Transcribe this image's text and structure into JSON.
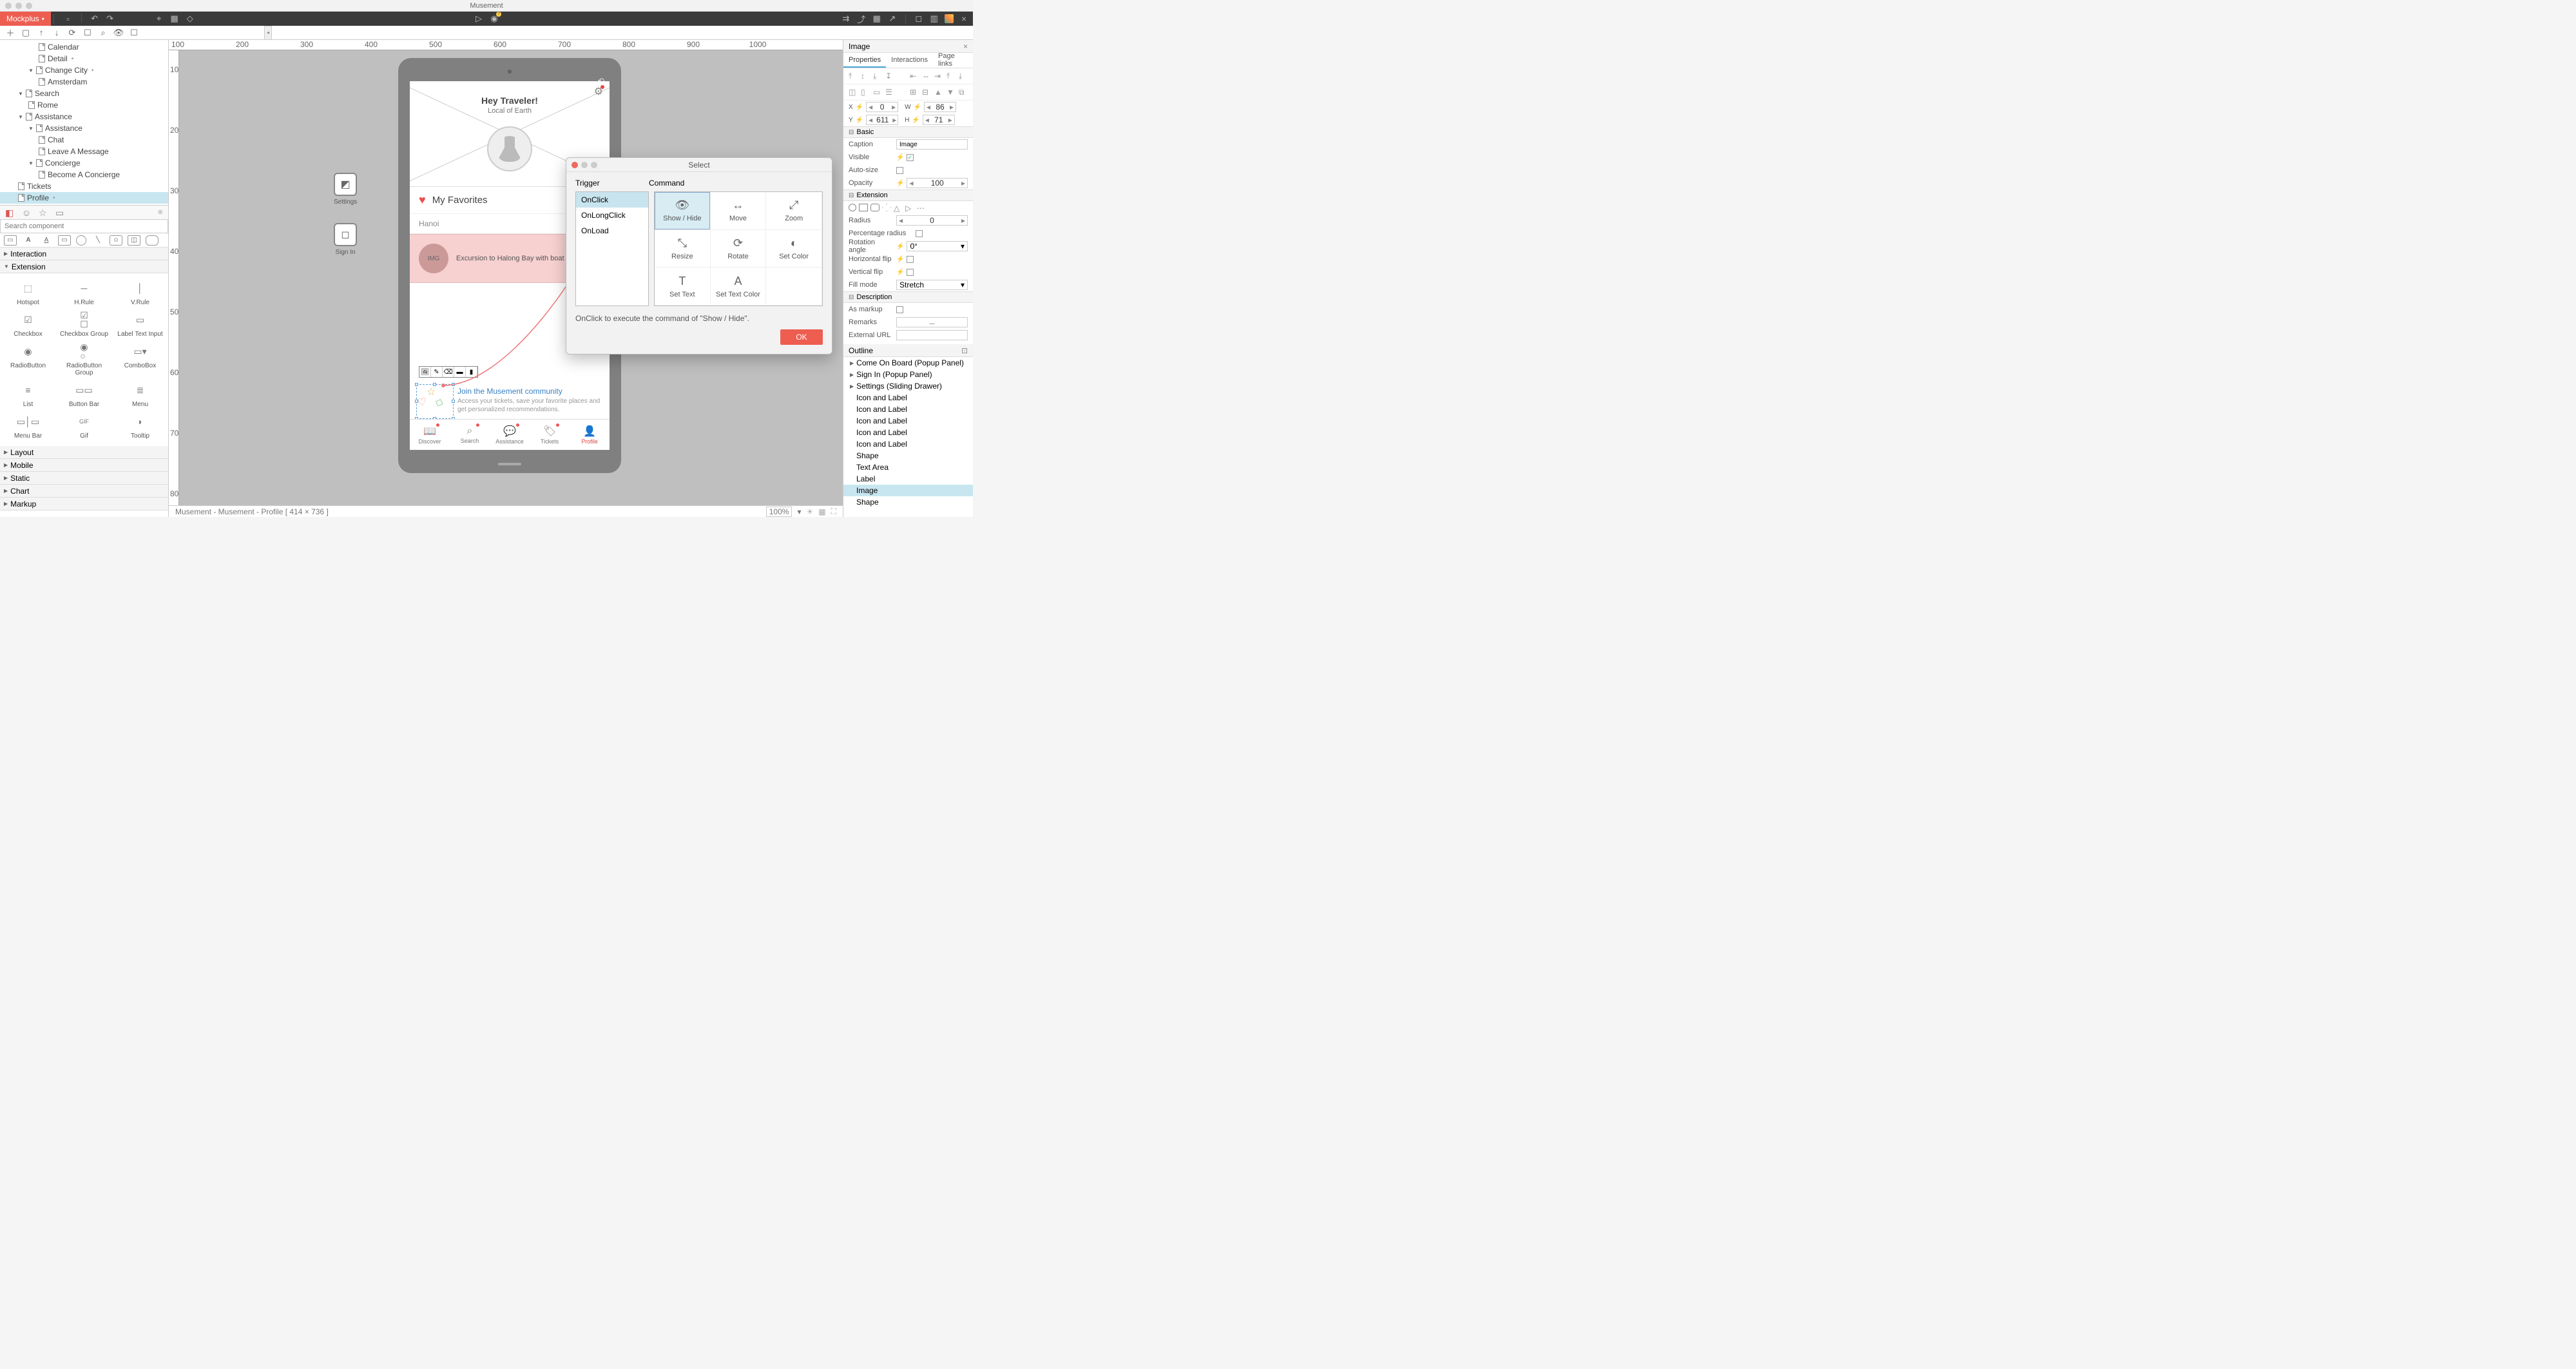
{
  "app_title": "Musement",
  "brand": "Mockplus",
  "tree": {
    "items": [
      {
        "label": "Calendar",
        "depth": 3,
        "icon": "page"
      },
      {
        "label": "Detail",
        "depth": 3,
        "icon": "page",
        "modified": true
      },
      {
        "label": "Change City",
        "depth": 2,
        "icon": "page",
        "expanded": true,
        "modified": true
      },
      {
        "label": "Amsterdam",
        "depth": 3,
        "icon": "page"
      },
      {
        "label": "Search",
        "depth": 1,
        "icon": "page",
        "expanded": true
      },
      {
        "label": "Rome",
        "depth": 2,
        "icon": "page"
      },
      {
        "label": "Assistance",
        "depth": 1,
        "icon": "page",
        "expanded": true
      },
      {
        "label": "Assistance",
        "depth": 2,
        "icon": "page",
        "expanded": true
      },
      {
        "label": "Chat",
        "depth": 3,
        "icon": "page"
      },
      {
        "label": "Leave A Message",
        "depth": 3,
        "icon": "page"
      },
      {
        "label": "Concierge",
        "depth": 2,
        "icon": "page",
        "expanded": true
      },
      {
        "label": "Become A Concierge",
        "depth": 3,
        "icon": "page"
      },
      {
        "label": "Tickets",
        "depth": 1,
        "icon": "page"
      },
      {
        "label": "Profile",
        "depth": 1,
        "icon": "page",
        "selected": true,
        "modified": true
      }
    ]
  },
  "component_search_placeholder": "Search component",
  "component_sections": {
    "interaction": {
      "label": "Interaction",
      "open": false
    },
    "extension": {
      "label": "Extension",
      "open": true,
      "items": [
        {
          "label": "Hotspot"
        },
        {
          "label": "H.Rule"
        },
        {
          "label": "V.Rule"
        },
        {
          "label": "Checkbox"
        },
        {
          "label": "Checkbox Group"
        },
        {
          "label": "Label Text Input"
        },
        {
          "label": "RadioButton"
        },
        {
          "label": "RadioButton Group"
        },
        {
          "label": "ComboBox"
        },
        {
          "label": "List"
        },
        {
          "label": "Button Bar"
        },
        {
          "label": "Menu"
        },
        {
          "label": "Menu Bar"
        },
        {
          "label": "Gif"
        },
        {
          "label": "Tooltip"
        }
      ]
    },
    "collapsed": [
      {
        "label": "Layout"
      },
      {
        "label": "Mobile"
      },
      {
        "label": "Static"
      },
      {
        "label": "Chart"
      },
      {
        "label": "Markup"
      }
    ]
  },
  "ruler_h": [
    "100",
    "200",
    "300",
    "400",
    "500",
    "600",
    "700",
    "800",
    "900",
    "1000"
  ],
  "ruler_v": [
    "100",
    "200",
    "300",
    "400",
    "500",
    "600",
    "700",
    "800"
  ],
  "float_settings": "Settings",
  "float_signin": "Sign In",
  "artboard": {
    "hero_title": "Hey Traveler!",
    "hero_sub": "Local of Earth",
    "fav_title": "My Favorites",
    "city": "Hanoi",
    "card_img": "IMG",
    "card_text": "Excursion to Halong Bay with boat rid",
    "join_title": "Join the Musement community",
    "join_desc": "Access your tickets, save your favorite places and get personalized recommendations.",
    "tabs": [
      "Discover",
      "Search",
      "Assistance",
      "Tickets",
      "Profile"
    ]
  },
  "dialog": {
    "title": "Select",
    "trigger_label": "Trigger",
    "command_label": "Command",
    "triggers": [
      "OnClick",
      "OnLongClick",
      "OnLoad"
    ],
    "trigger_selected": "OnClick",
    "commands": [
      "Show / Hide",
      "Move",
      "Zoom",
      "Resize",
      "Rotate",
      "Set Color",
      "Set Text",
      "Set Text Color"
    ],
    "command_selected": "Show / Hide",
    "desc": "OnClick to execute the command of \"Show / Hide\".",
    "ok": "OK"
  },
  "status_text": "Musement - Musement - Profile [ 414 × 736 ]",
  "zoom": "100%",
  "right_panel": {
    "title": "Image",
    "tabs": [
      "Properties",
      "Interactions",
      "Page links"
    ],
    "X": "0",
    "Y": "611",
    "W": "86",
    "H": "71",
    "basic": "Basic",
    "caption_lb": "Caption",
    "caption_val": "Image",
    "visible_lb": "Visible",
    "visible": true,
    "autosize_lb": "Auto-size",
    "autosize": false,
    "opacity_lb": "Opacity",
    "opacity": "100",
    "extension": "Extension",
    "radius_lb": "Radius",
    "radius": "0",
    "pctradius_lb": "Percentage radius",
    "pctradius": false,
    "rotation_lb": "Rotation angle",
    "rotation": "0°",
    "hflip_lb": "Horizontal flip",
    "hflip": false,
    "vflip_lb": "Vertical flip",
    "vflip": false,
    "fillmode_lb": "Fill mode",
    "fillmode": "Stretch",
    "description": "Description",
    "markup_lb": "As markup",
    "markup": false,
    "remarks_lb": "Remarks",
    "remarks": "...",
    "url_lb": "External URL",
    "url": ""
  },
  "outline": {
    "title": "Outline",
    "items": [
      {
        "label": "Come On Board (Popup Panel)",
        "depth": 0,
        "exp": true
      },
      {
        "label": "Sign In (Popup Panel)",
        "depth": 0,
        "exp": true
      },
      {
        "label": "Settings (Sliding Drawer)",
        "depth": 0,
        "exp": true
      },
      {
        "label": "Icon and Label",
        "depth": 1
      },
      {
        "label": "Icon and Label",
        "depth": 1
      },
      {
        "label": "Icon and Label",
        "depth": 1
      },
      {
        "label": "Icon and Label",
        "depth": 1
      },
      {
        "label": "Icon and Label",
        "depth": 1
      },
      {
        "label": "Shape",
        "depth": 1
      },
      {
        "label": "Text Area",
        "depth": 1
      },
      {
        "label": "Label",
        "depth": 1
      },
      {
        "label": "Image",
        "depth": 1,
        "selected": true
      },
      {
        "label": "Shape",
        "depth": 1
      }
    ]
  }
}
